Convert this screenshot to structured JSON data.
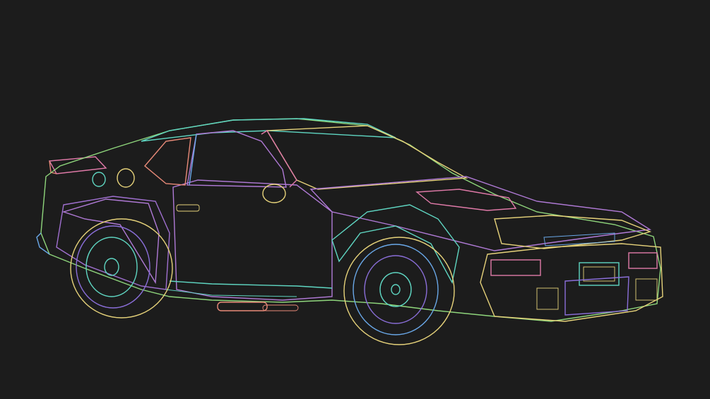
{
  "scene": {
    "background": "#1c1c1c",
    "subject": "wireframe-sports-car",
    "palette": {
      "yellow": "#e6d27a",
      "green": "#8fd67c",
      "teal": "#5fd6c2",
      "purple": "#b07ad6",
      "violet": "#8a6ed8",
      "pink": "#e07aa8",
      "salmon": "#e88a78",
      "blue": "#6aa8e8"
    }
  }
}
